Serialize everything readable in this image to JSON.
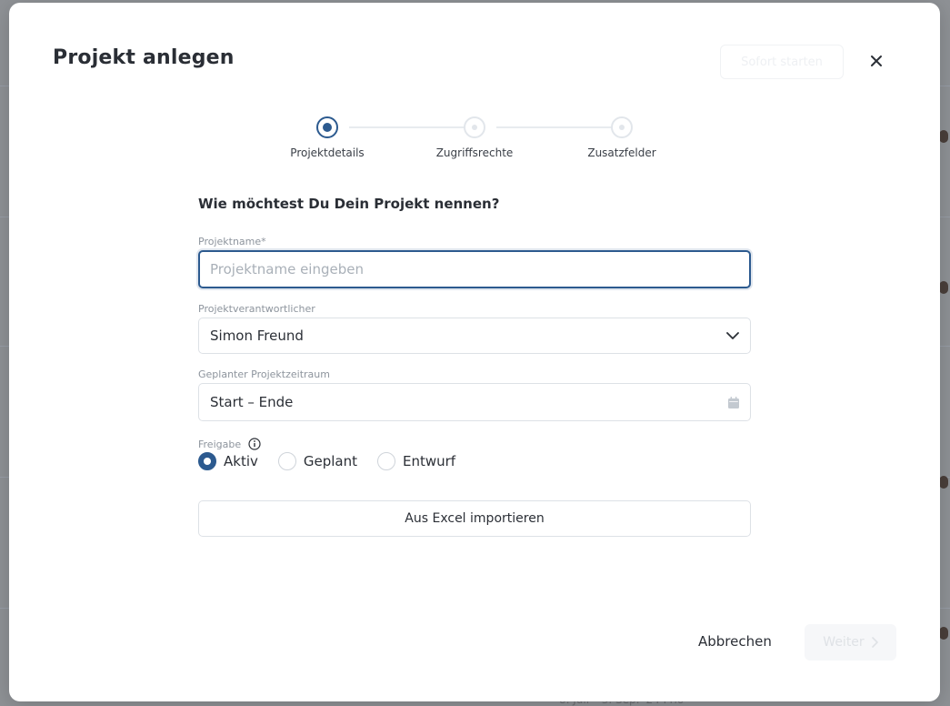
{
  "background": {
    "peek_text": "8. Juli – 3. Sep. '24    Prio"
  },
  "modal": {
    "title": "Projekt anlegen",
    "sofort_starten_label": "Sofort starten",
    "close_icon": "close-icon"
  },
  "stepper": {
    "steps": [
      {
        "label": "Projektdetails",
        "state": "active"
      },
      {
        "label": "Zugriffsrechte",
        "state": "inactive"
      },
      {
        "label": "Zusatzfelder",
        "state": "inactive"
      }
    ]
  },
  "form": {
    "question": "Wie möchtest Du Dein Projekt nennen?",
    "project_name": {
      "label": "Projektname*",
      "placeholder": "Projektname eingeben",
      "value": ""
    },
    "responsible": {
      "label": "Projektverantwortlicher",
      "value": "Simon Freund",
      "icon": "chevron-down-icon"
    },
    "period": {
      "label": "Geplanter Projektzeitraum",
      "value": "Start – Ende",
      "icon": "calendar-icon"
    },
    "release": {
      "label": "Freigabe",
      "info_icon": "info-icon",
      "options": [
        {
          "label": "Aktiv",
          "checked": true
        },
        {
          "label": "Geplant",
          "checked": false
        },
        {
          "label": "Entwurf",
          "checked": false
        }
      ]
    },
    "import_label": "Aus Excel importieren"
  },
  "footer": {
    "cancel_label": "Abbrechen",
    "next_label": "Weiter",
    "next_icon": "chevron-right-icon"
  },
  "colors": {
    "accent": "#2c5a8f",
    "overlay": "#8f9296",
    "border": "#dde1e6"
  }
}
